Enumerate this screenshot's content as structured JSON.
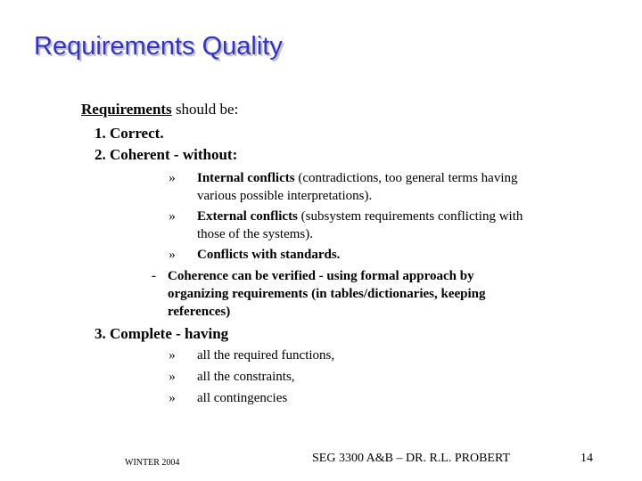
{
  "slide": {
    "title": "Requirements Quality",
    "intro": {
      "keyword": "Requirements",
      "rest": " should be:"
    },
    "items": [
      {
        "label": "1. Correct."
      },
      {
        "label": "2. Coherent - without:"
      },
      {
        "label": "3. Complete - having"
      }
    ],
    "coherent_bullets": [
      {
        "marker": "»",
        "bold": "Internal conflicts",
        "line1_rest": " (contradictions, too general terms having",
        "line2": "various possible interpretations)."
      },
      {
        "marker": "»",
        "bold": "External conflicts",
        "line1_rest": " (subsystem requirements conflicting with",
        "line2": "those of the systems)."
      },
      {
        "marker": "»",
        "bold": "Conflicts with standards.",
        "line1_rest": "",
        "line2": ""
      }
    ],
    "coherence_note": {
      "marker": "-",
      "lines": [
        "Coherence can be verified - using formal approach by",
        "organizing requirements (in tables/dictionaries, keeping",
        "references)"
      ]
    },
    "complete_bullets": [
      {
        "marker": "»",
        "text": "all the required functions,"
      },
      {
        "marker": "»",
        "text": "all the constraints,"
      },
      {
        "marker": "»",
        "text": "all contingencies"
      }
    ]
  },
  "footer": {
    "left": "WINTER 2004",
    "center": "SEG 3300 A&B – DR. R.L. PROBERT",
    "page_number": "14"
  }
}
